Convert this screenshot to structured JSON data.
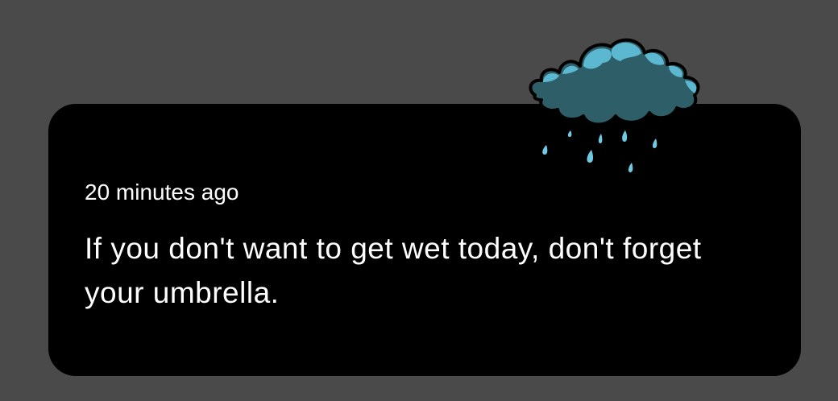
{
  "notification": {
    "timestamp": "20 minutes ago",
    "message": "If you don't want to get wet today, don't forget your umbrella.",
    "icon": "rain-cloud-icon"
  },
  "colors": {
    "background": "#4a4a4a",
    "card": "#000000",
    "text": "#ffffff",
    "cloud_dark": "#2e5f69",
    "cloud_light": "#5cb8d0",
    "rain": "#6fc9e0"
  }
}
